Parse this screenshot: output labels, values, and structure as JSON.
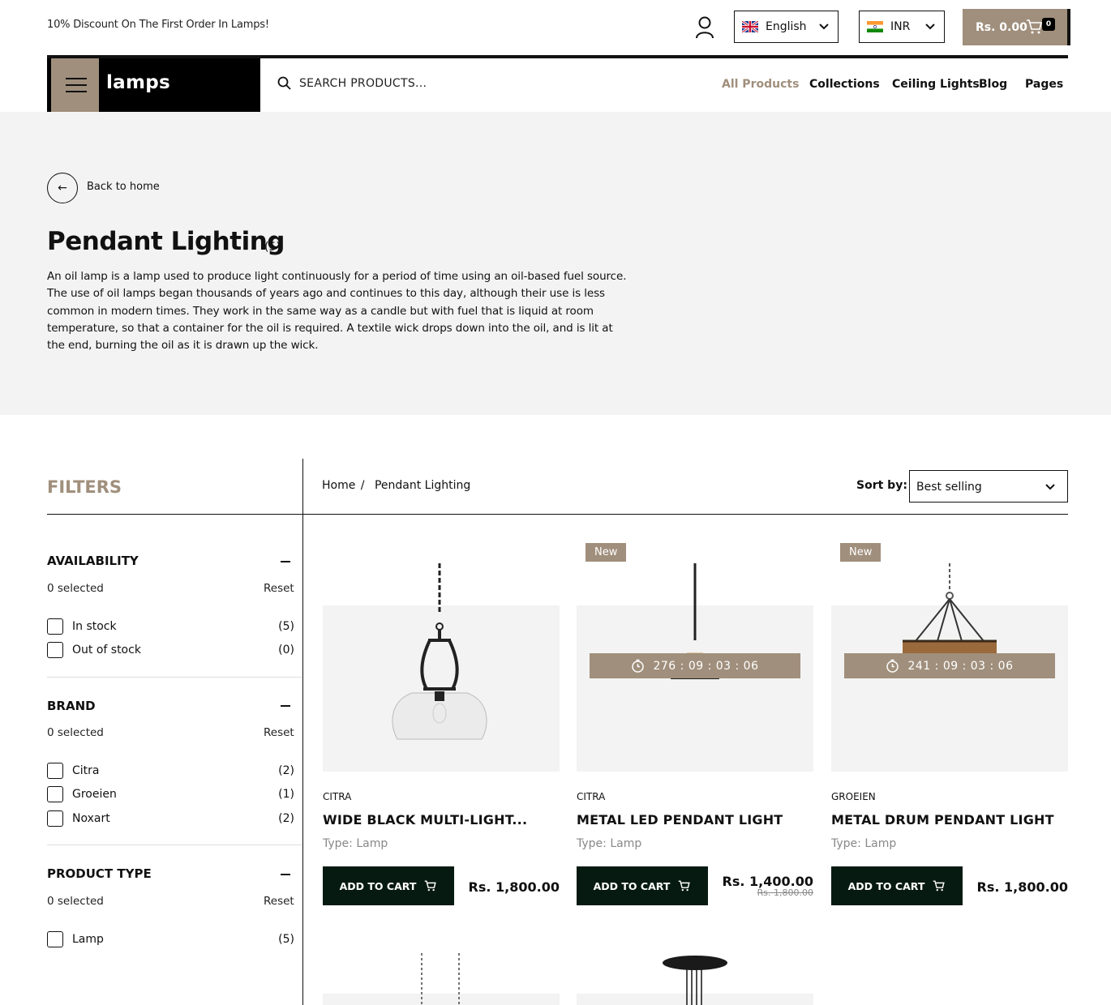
{
  "topbar": {
    "promo": "10% Discount On The First Order In Lamps!",
    "language": "English",
    "currency": "INR",
    "cart_total": "Rs. 0.00",
    "cart_count": "0"
  },
  "header": {
    "logo": "lamps",
    "search_placeholder": "SEARCH PRODUCTS...",
    "nav": [
      "All Products",
      "Collections",
      "Ceiling Lights",
      "Blog",
      "Pages"
    ],
    "active_nav": "All Products"
  },
  "hero": {
    "back_label": "Back to home",
    "title": "Pendant Lighting",
    "count": "(5)",
    "description": "An oil lamp is a lamp used to produce light continuously for a period of time using an oil-based fuel source. The use of oil lamps began thousands of years ago and continues to this day, although their use is less common in modern times. They work in the same way as a candle but with fuel that is liquid at room temperature, so that a container for the oil is required. A textile wick drops down into the oil, and is lit at the end, burning the oil as it is drawn up the wick."
  },
  "filters": {
    "title": "FILTERS",
    "groups": [
      {
        "name": "AVAILABILITY",
        "selected": "0 selected",
        "reset": "Reset",
        "options": [
          {
            "label": "In stock",
            "count": "(5)"
          },
          {
            "label": "Out of stock",
            "count": "(0)"
          }
        ]
      },
      {
        "name": "BRAND",
        "selected": "0 selected",
        "reset": "Reset",
        "options": [
          {
            "label": "Citra",
            "count": "(2)"
          },
          {
            "label": "Groeien",
            "count": "(1)"
          },
          {
            "label": "Noxart",
            "count": "(2)"
          }
        ]
      },
      {
        "name": "PRODUCT TYPE",
        "selected": "0 selected",
        "reset": "Reset",
        "options": [
          {
            "label": "Lamp",
            "count": "(5)"
          }
        ]
      }
    ]
  },
  "listing": {
    "breadcrumb_home": "Home",
    "breadcrumb_sep": "/",
    "breadcrumb_current": "Pendant Lighting",
    "sort_label": "Sort by:",
    "sort_value": "Best selling",
    "products": [
      {
        "vendor": "CITRA",
        "title": "WIDE BLACK MULTI-LIGHT...",
        "type": "Type: Lamp",
        "price": "Rs. 1,800.00",
        "old_price": "",
        "badge": "",
        "timer": "",
        "cta": "ADD TO CART"
      },
      {
        "vendor": "CITRA",
        "title": "METAL LED PENDANT LIGHT",
        "type": "Type: Lamp",
        "price": "Rs. 1,400.00",
        "old_price": "Rs. 1,800.00",
        "badge": "New",
        "timer": "276 : 09 : 03 : 06",
        "cta": "ADD TO CART"
      },
      {
        "vendor": "GROEIEN",
        "title": "METAL DRUM PENDANT LIGHT",
        "type": "Type: Lamp",
        "price": "Rs. 1,800.00",
        "old_price": "",
        "badge": "New",
        "timer": "241 : 09 : 03 : 06",
        "cta": "ADD TO CART"
      }
    ]
  },
  "colors": {
    "accent": "#a08f7c",
    "dark": "#071a12",
    "hero_bg": "#f3f3f3"
  }
}
